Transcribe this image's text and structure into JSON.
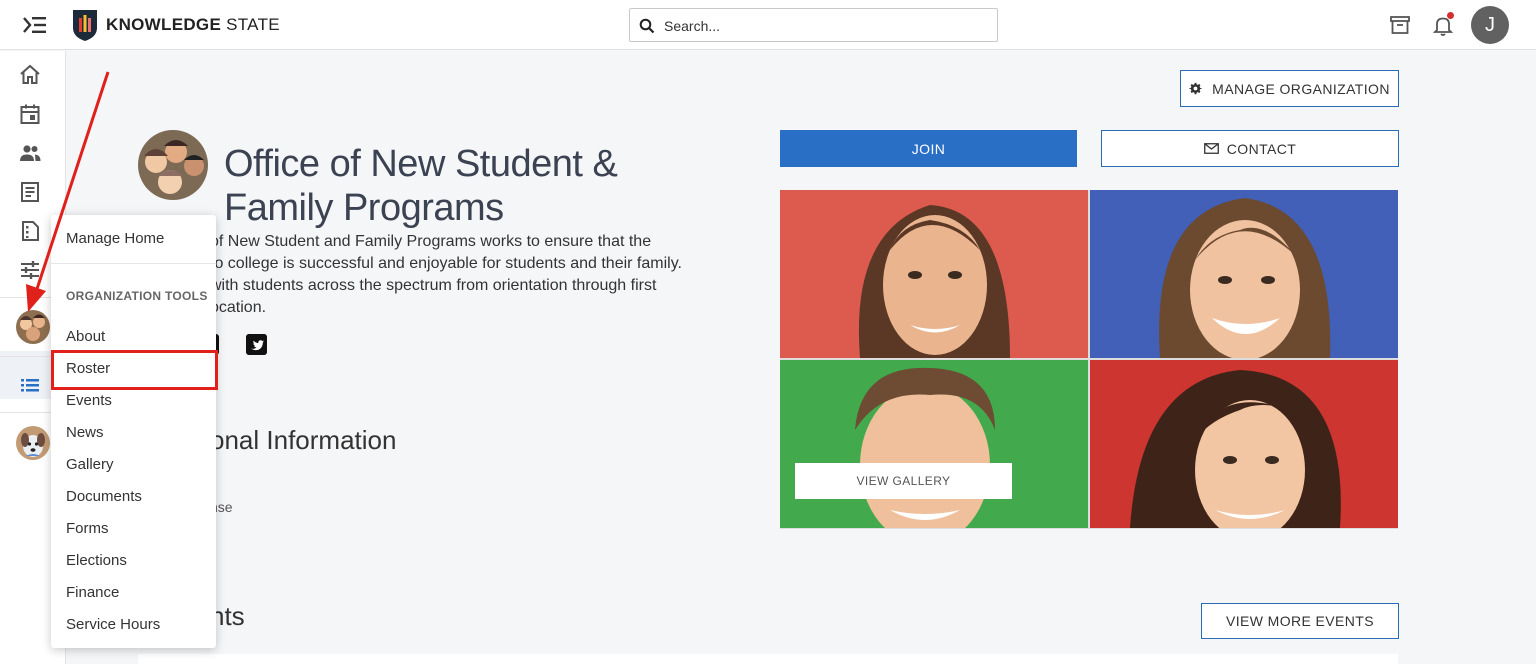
{
  "app": {
    "brand_bold": "KNOWLEDGE",
    "brand_light": "STATE",
    "search_placeholder": "Search...",
    "user_initial": "J"
  },
  "organization": {
    "title": "Office of New Student & Family Programs",
    "description_lines": [
      "of New Student and Family Programs works to ensure that the",
      "to college is successful and enjoyable for students and their family.",
      "with students across the spectrum from orientation through first",
      "ocation."
    ],
    "section_info": "onal Information",
    "section_info_detail": "nse",
    "section_events": "nts"
  },
  "buttons": {
    "manage_org": "MANAGE ORGANIZATION",
    "join": "JOIN",
    "contact": "CONTACT",
    "view_gallery": "VIEW GALLERY",
    "view_more_events": "VIEW MORE EVENTS"
  },
  "dropdown": {
    "home": "Manage Home",
    "section_title": "ORGANIZATION TOOLS",
    "items": [
      "About",
      "Roster",
      "Events",
      "News",
      "Gallery",
      "Documents",
      "Forms",
      "Elections",
      "Finance",
      "Service Hours"
    ]
  },
  "colors": {
    "primary": "#2a6fc6",
    "highlight": "#e0201a",
    "notification": "#d32f2f"
  },
  "icons": [
    "menu-toggle-icon",
    "search-icon",
    "archive-icon",
    "bell-icon",
    "home-icon",
    "calendar-icon",
    "groups-icon",
    "document-list-icon",
    "form-icon",
    "sliders-icon",
    "list-icon",
    "gear-icon",
    "mail-icon",
    "twitter-icon"
  ]
}
